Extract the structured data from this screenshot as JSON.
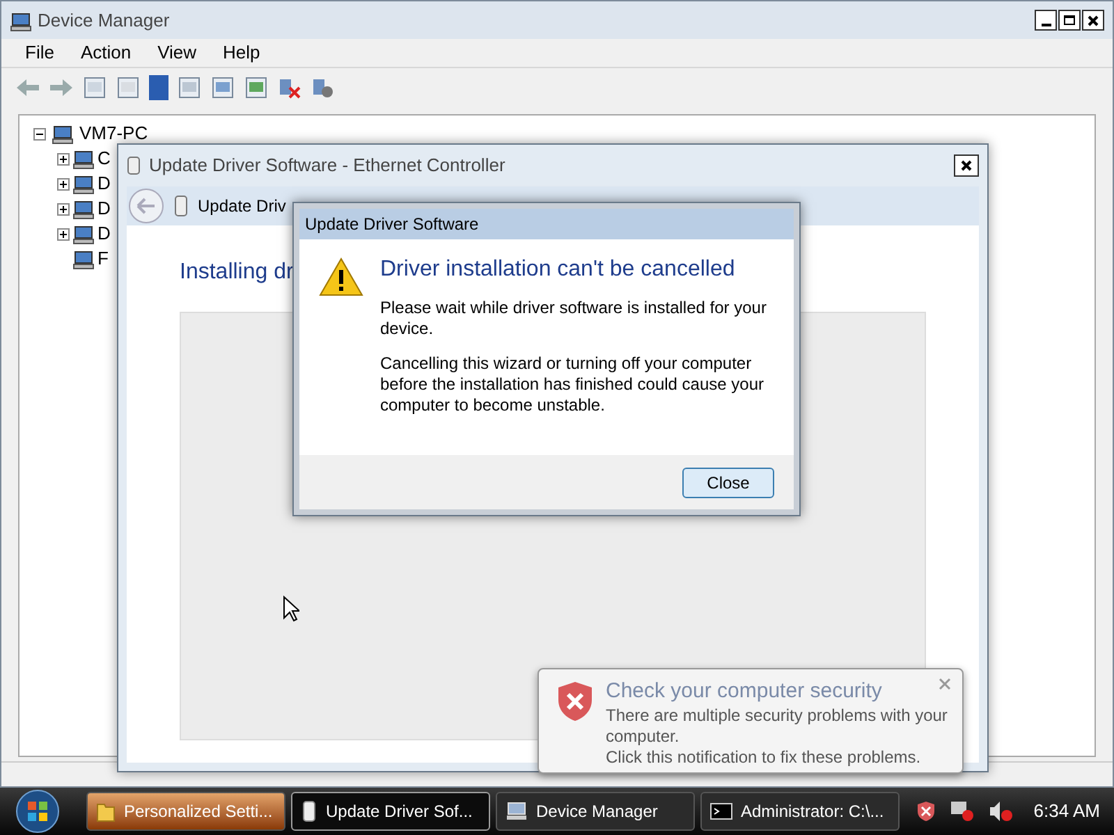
{
  "device_manager": {
    "title": "Device Manager",
    "menu": [
      "File",
      "Action",
      "View",
      "Help"
    ],
    "tree": {
      "label": "VM7-PC",
      "expanded": true,
      "children": [
        {
          "label": "C",
          "kind": "group"
        },
        {
          "label": "D",
          "kind": "group"
        },
        {
          "label": "D",
          "kind": "group"
        },
        {
          "label": "D",
          "kind": "group"
        },
        {
          "label": "F",
          "kind": "leaf"
        }
      ]
    }
  },
  "wizard": {
    "title": "Update Driver Software - Ethernet Controller",
    "nav_title": "Update Driv",
    "heading": "Installing dr"
  },
  "dialog": {
    "title": "Update Driver Software",
    "heading": "Driver installation can't be cancelled",
    "paragraphs": [
      "Please wait while driver software is installed for your device.",
      "Cancelling this wizard or turning off your computer before the installation has finished could cause your computer to become unstable."
    ],
    "buttons": [
      "Close"
    ]
  },
  "notification": {
    "title": "Check your computer security",
    "lines": [
      "There are multiple security problems with your computer.",
      "Click this notification to fix these problems."
    ]
  },
  "taskbar": {
    "items": [
      {
        "label": "Personalized Setti...",
        "kind": "folder",
        "selected": false,
        "flashing": true
      },
      {
        "label": "Update Driver Sof...",
        "kind": "driver",
        "selected": true,
        "flashing": false
      },
      {
        "label": "Device Manager",
        "kind": "computer",
        "selected": false,
        "flashing": false
      },
      {
        "label": "Administrator: C:\\...",
        "kind": "console",
        "selected": false,
        "flashing": false
      }
    ],
    "clock": "6:34 AM"
  }
}
